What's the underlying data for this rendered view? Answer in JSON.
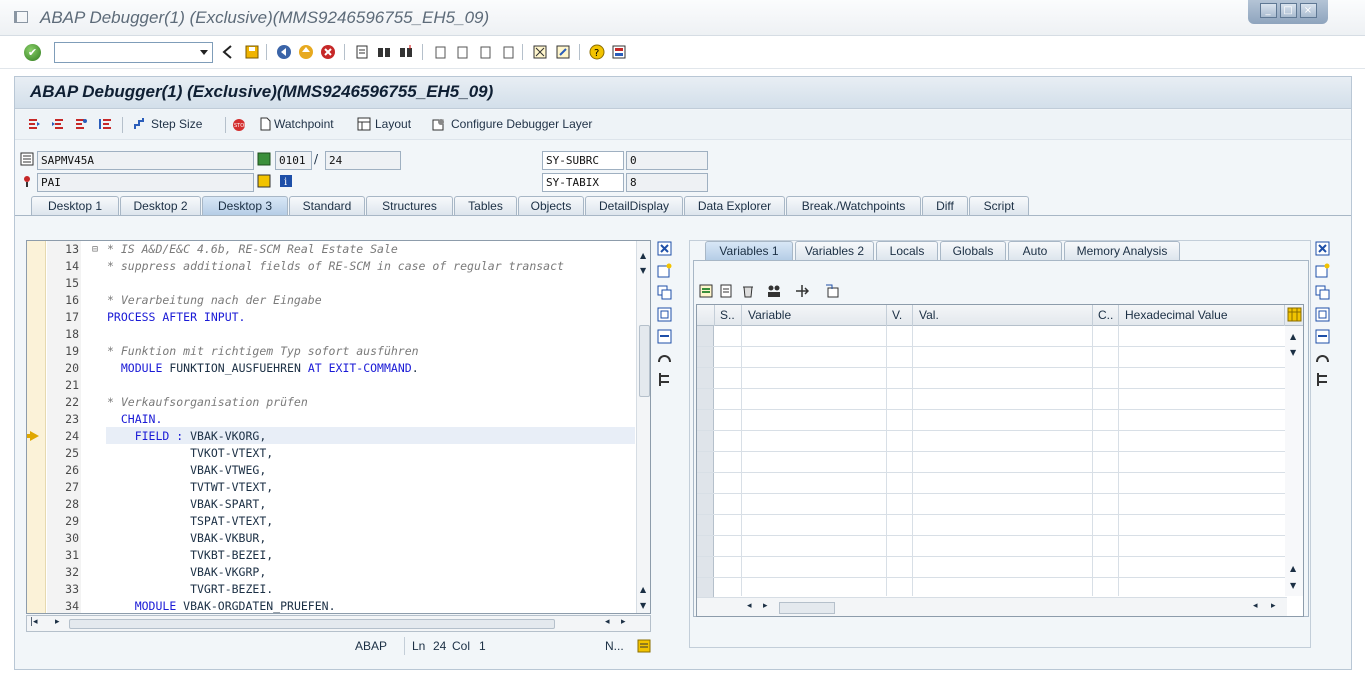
{
  "window": {
    "title": "ABAP Debugger(1)  (Exclusive)(MMS9246596755_EH5_09)"
  },
  "header": {
    "title": "ABAP Debugger(1)  (Exclusive)(MMS9246596755_EH5_09)"
  },
  "app_toolbar": {
    "step_size": "Step Size",
    "watchpoint": "Watchpoint",
    "layout": "Layout",
    "configure": "Configure Debugger Layer"
  },
  "fields": {
    "program": "SAPMV45A",
    "event": "PAI",
    "screen": "0101",
    "line": "24",
    "slash": "/",
    "sy_subrc_label": "SY-SUBRC",
    "sy_subrc_value": "0",
    "sy_tabix_label": "SY-TABIX",
    "sy_tabix_value": "8"
  },
  "tabs": [
    "Desktop 1",
    "Desktop 2",
    "Desktop 3",
    "Standard",
    "Structures",
    "Tables",
    "Objects",
    "DetailDisplay",
    "Data Explorer",
    "Break./Watchpoints",
    "Diff",
    "Script"
  ],
  "active_tab": "Desktop 3",
  "code": [
    {
      "n": "13",
      "t": "* IS A&D/E&C 4.6b, RE-SCM Real Estate Sale",
      "c": "cmt"
    },
    {
      "n": "14",
      "t": "* suppress additional fields of RE-SCM in case of regular transact",
      "c": "cmt"
    },
    {
      "n": "15",
      "t": "",
      "c": ""
    },
    {
      "n": "16",
      "t": "* Verarbeitung nach der Eingabe",
      "c": "cmt"
    },
    {
      "n": "17",
      "t": "PROCESS AFTER INPUT.",
      "c": "kw"
    },
    {
      "n": "18",
      "t": "",
      "c": ""
    },
    {
      "n": "19",
      "t": "* Funktion mit richtigem Typ sofort ausführen",
      "c": "cmt"
    },
    {
      "n": "20",
      "t": "  MODULE FUNKTION_AUSFUEHREN AT EXIT-COMMAND.",
      "c": "mix20"
    },
    {
      "n": "21",
      "t": "",
      "c": ""
    },
    {
      "n": "22",
      "t": "* Verkaufsorganisation prüfen",
      "c": "cmt"
    },
    {
      "n": "23",
      "t": "  CHAIN.",
      "c": "kw"
    },
    {
      "n": "24",
      "t": "    FIELD : VBAK-VKORG,",
      "c": "mix24"
    },
    {
      "n": "25",
      "t": "            TVKOT-VTEXT,",
      "c": ""
    },
    {
      "n": "26",
      "t": "            VBAK-VTWEG,",
      "c": ""
    },
    {
      "n": "27",
      "t": "            TVTWT-VTEXT,",
      "c": ""
    },
    {
      "n": "28",
      "t": "            VBAK-SPART,",
      "c": ""
    },
    {
      "n": "29",
      "t": "            TSPAT-VTEXT,",
      "c": ""
    },
    {
      "n": "30",
      "t": "            VBAK-VKBUR,",
      "c": ""
    },
    {
      "n": "31",
      "t": "            TVKBT-BEZEI,",
      "c": ""
    },
    {
      "n": "32",
      "t": "            VBAK-VKGRP,",
      "c": ""
    },
    {
      "n": "33",
      "t": "            TVGRT-BEZEI.",
      "c": ""
    },
    {
      "n": "34",
      "t": "    MODULE VBAK-ORGDATEN_PRUEFEN.",
      "c": "mix34"
    }
  ],
  "status": {
    "lang": "ABAP",
    "ln_label": "Ln",
    "ln": "24",
    "col_label": "Col",
    "col": "1",
    "mode": "N..."
  },
  "right_tabs": [
    "Variables 1",
    "Variables 2",
    "Locals",
    "Globals",
    "Auto",
    "Memory Analysis"
  ],
  "right_active": "Variables 1",
  "grid_headers": [
    "S..",
    "Variable",
    "V.",
    "Val.",
    "C..",
    "Hexadecimal Value"
  ],
  "colors": {
    "keyword": "#1a1ad6",
    "comment": "#7a7a7a",
    "accent": "#b5cde6"
  }
}
